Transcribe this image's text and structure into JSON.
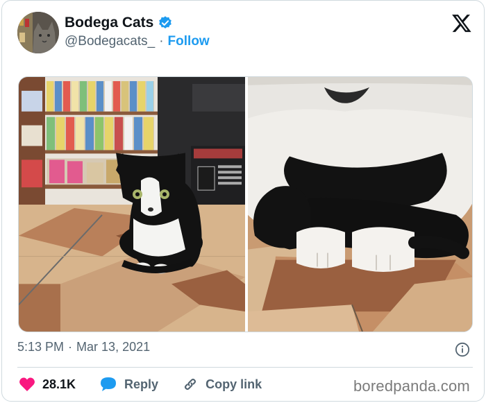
{
  "author": {
    "name": "Bodega Cats",
    "handle": "@Bodegacats_",
    "separator": "·",
    "follow_label": "Follow",
    "verified_icon": "verified-badge-icon",
    "verified_color": "#1d9bf0"
  },
  "brand_icon": "x-logo-icon",
  "media": {
    "images": [
      {
        "description_icon": "cat-photo-bodega-shelves"
      },
      {
        "description_icon": "cat-photo-closeup-paws"
      }
    ]
  },
  "meta": {
    "time": "5:13 PM",
    "separator": "·",
    "date": "Mar 13, 2021",
    "info_icon": "info-icon"
  },
  "actions": {
    "like_count": "28.1K",
    "like_color": "#f91880",
    "reply_label": "Reply",
    "reply_color": "#1d9bf0",
    "copy_label": "Copy link"
  },
  "watermark": "boredpanda.com"
}
